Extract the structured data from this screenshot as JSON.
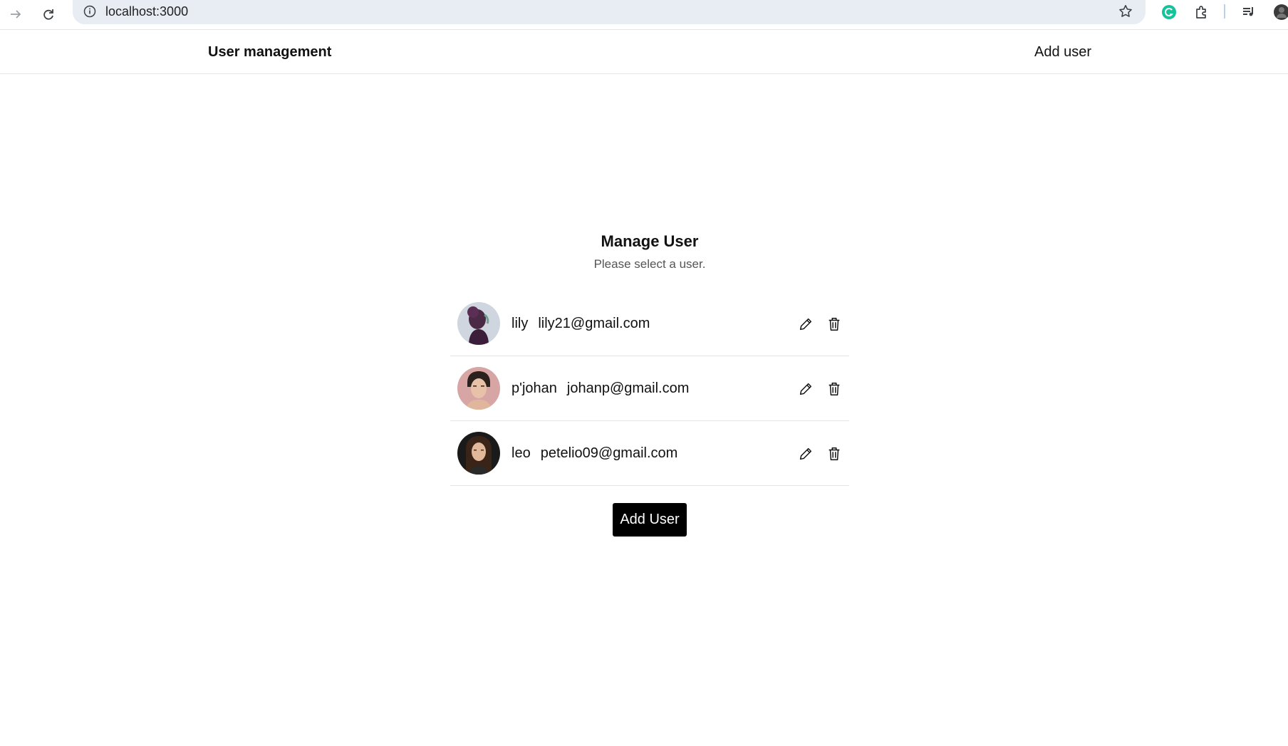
{
  "browser": {
    "url": "localhost:3000"
  },
  "header": {
    "brand": "User management",
    "nav_add": "Add user"
  },
  "main": {
    "title": "Manage User",
    "subtitle": "Please select a user."
  },
  "users": [
    {
      "name": "lily",
      "email": "lily21@gmail.com",
      "avatar_icon": "avatar-lily"
    },
    {
      "name": "p'johan",
      "email": "johanp@gmail.com",
      "avatar_icon": "avatar-johan"
    },
    {
      "name": "leo",
      "email": "petelio09@gmail.com",
      "avatar_icon": "avatar-leo"
    }
  ],
  "add_button": "Add User",
  "colors": {
    "accent": "#000000",
    "omnibox": "#e7edf3",
    "grammarly": "#15c39a"
  }
}
